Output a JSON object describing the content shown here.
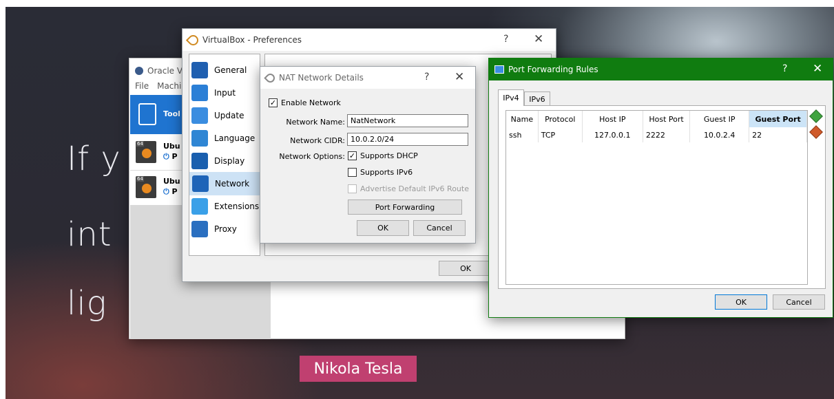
{
  "background": {
    "lines": [
      "If y",
      "int",
      "lig"
    ],
    "quote": "Nikola Tesla"
  },
  "vbox_manager": {
    "title": "Oracle Vi",
    "menu": [
      "File",
      "Machi"
    ],
    "tools_label": "Tool",
    "vms": [
      {
        "name": "Ubu",
        "state": "P",
        "badge": "64"
      },
      {
        "name": "Ubu",
        "state": "P",
        "badge": "64"
      }
    ]
  },
  "preferences": {
    "title": "VirtualBox - Preferences",
    "help": "?",
    "close": "✕",
    "nav": [
      {
        "label": "General",
        "icon": "general-icon",
        "color": "#1f5fb0"
      },
      {
        "label": "Input",
        "icon": "input-icon",
        "color": "#2b7fd6"
      },
      {
        "label": "Update",
        "icon": "update-icon",
        "color": "#3a8de0"
      },
      {
        "label": "Language",
        "icon": "language-icon",
        "color": "#2f86d4"
      },
      {
        "label": "Display",
        "icon": "display-icon",
        "color": "#1a5fae"
      },
      {
        "label": "Network",
        "icon": "network-icon",
        "color": "#1e64b8"
      },
      {
        "label": "Extensions",
        "icon": "extensions-icon",
        "color": "#3aa0e8"
      },
      {
        "label": "Proxy",
        "icon": "proxy-icon",
        "color": "#2a6fc0"
      }
    ],
    "selected": "Network",
    "ok_label": "OK"
  },
  "nat": {
    "title": "NAT Network Details",
    "help": "?",
    "close": "✕",
    "enable_label": "Enable Network",
    "enable_checked": "✓",
    "name_label": "Network Name:",
    "name_value": "NatNetwork",
    "cidr_label": "Network CIDR:",
    "cidr_value": "10.0.2.0/24",
    "options_label": "Network Options:",
    "dhcp_label": "Supports DHCP",
    "dhcp_checked": "✓",
    "ipv6_label": "Supports IPv6",
    "route_label": "Advertise Default IPv6 Route",
    "port_forwarding_label": "Port Forwarding",
    "ok_label": "OK",
    "cancel_label": "Cancel"
  },
  "pfr": {
    "title": "Port Forwarding Rules",
    "help": "?",
    "close": "✕",
    "tabs": [
      "IPv4",
      "IPv6"
    ],
    "columns": [
      "Name",
      "Protocol",
      "Host IP",
      "Host Port",
      "Guest IP",
      "Guest Port"
    ],
    "rows": [
      {
        "name": "ssh",
        "protocol": "TCP",
        "host_ip": "127.0.0.1",
        "host_port": "2222",
        "guest_ip": "10.0.2.4",
        "guest_port": "22"
      }
    ],
    "ok_label": "OK",
    "cancel_label": "Cancel",
    "accent": "#107c10"
  }
}
